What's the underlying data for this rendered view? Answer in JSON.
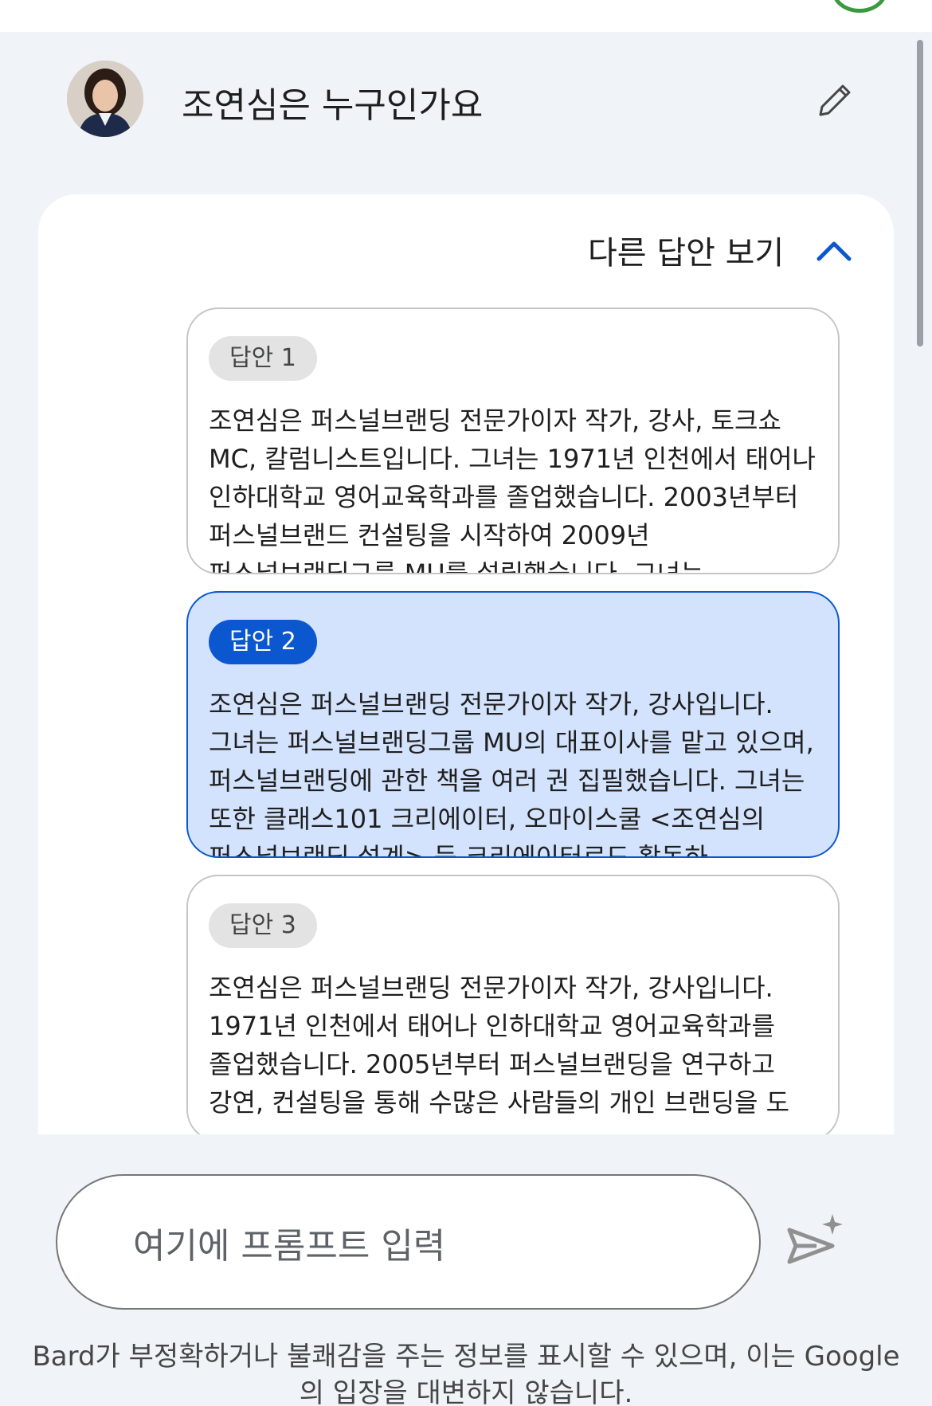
{
  "query": {
    "text": "조연심은 누구인가요",
    "avatar_icon": "user-photo",
    "edit_icon": "pencil-icon"
  },
  "drafts_toggle": {
    "label": "다른 답안 보기",
    "icon": "chevron-up-icon",
    "accent_color": "#0b57d0"
  },
  "drafts": [
    {
      "label": "답안 1",
      "selected": false,
      "text": "조연심은 퍼스널브랜딩 전문가이자 작가, 강사, 토크쇼 MC, 칼럼니스트입니다. 그녀는 1971년 인천에서 태어나 인하대학교 영어교육학과를 졸업했습니다. 2003년부터 퍼스널브랜드 컨설팅을 시작하여 2009년 퍼스널브랜딩그룹 MU를 설립했습니다. 그녀는 [퍼스널브랜딩"
    },
    {
      "label": "답안 2",
      "selected": true,
      "text": "조연심은 퍼스널브랜딩 전문가이자 작가, 강사입니다. 그녀는 퍼스널브랜딩그룹 MU의 대표이사를 맡고 있으며, 퍼스널브랜딩에 관한 책을 여러 권 집필했습니다. 그녀는 또한 클래스101 크리에이터, 오마이스쿨 <조연심의 퍼스널브랜딩 설계> 등 크리에이터로도 활동하"
    },
    {
      "label": "답안 3",
      "selected": false,
      "text": "조연심은 퍼스널브랜딩 전문가이자 작가, 강사입니다. 1971년 인천에서 태어나 인하대학교 영어교육학과를 졸업했습니다. 2005년부터 퍼스널브랜딩을 연구하고 강연, 컨설팅을 통해 수많은 사람들의 개인 브랜딩을 도"
    }
  ],
  "prompt": {
    "placeholder": "여기에 프롬프트 입력",
    "send_icon": "send-sparkle-icon"
  },
  "disclaimer": "Bard가 부정확하거나 불쾌감을 주는 정보를 표시할 수 있으며, 이는 Google의 입장을 대변하지 않습니다."
}
